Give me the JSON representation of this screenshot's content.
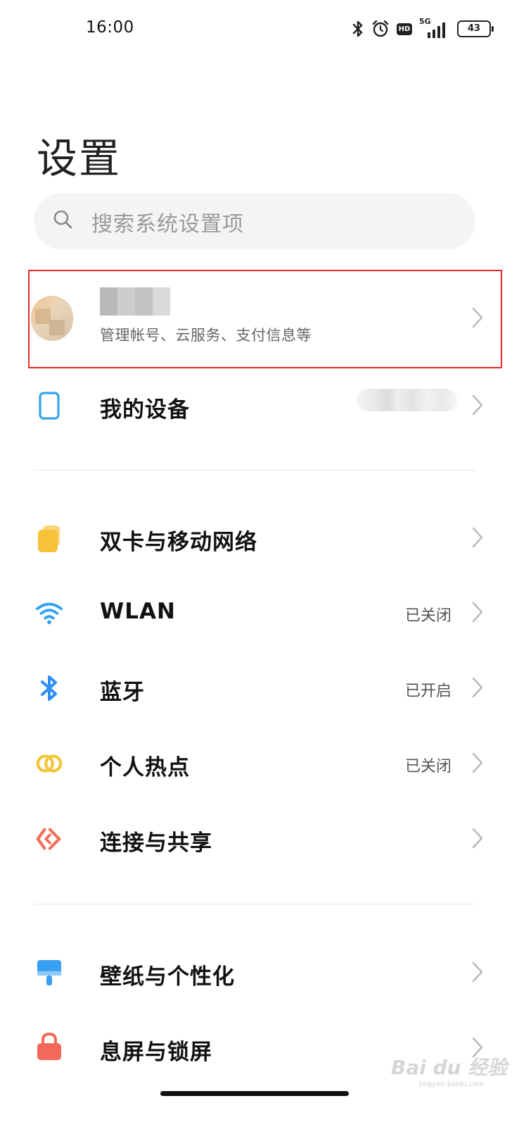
{
  "status_bar": {
    "time": "16:00",
    "network": "5G",
    "hd": "HD",
    "battery": "43",
    "icons": [
      "bluetooth-icon",
      "alarm-icon",
      "hd-icon",
      "signal-icon",
      "battery-icon"
    ]
  },
  "title": "设置",
  "search": {
    "placeholder": "搜索系统设置项"
  },
  "account": {
    "subtitle": "管理帐号、云服务、支付信息等"
  },
  "my_device": {
    "label": "我的设备"
  },
  "items": [
    {
      "label": "双卡与移动网络",
      "value": "",
      "icon": "sim-card-icon",
      "color": "#f7c23a"
    },
    {
      "label": "WLAN",
      "value": "已关闭",
      "icon": "wifi-icon",
      "color": "#2fa2f2"
    },
    {
      "label": "蓝牙",
      "value": "已开启",
      "icon": "bluetooth-icon",
      "color": "#2f8ef2"
    },
    {
      "label": "个人热点",
      "value": "已关闭",
      "icon": "hotspot-icon",
      "color": "#f2c53a"
    },
    {
      "label": "连接与共享",
      "value": "",
      "icon": "share-icon",
      "color": "#f0705a"
    },
    {
      "label": "壁纸与个性化",
      "value": "",
      "icon": "wallpaper-icon",
      "color": "#3aa0f2"
    },
    {
      "label": "息屏与锁屏",
      "value": "",
      "icon": "lock-icon",
      "color": "#f4685a"
    }
  ],
  "watermark": {
    "text": "Bai du 经验",
    "sub": "jingyan.baidu.com"
  }
}
